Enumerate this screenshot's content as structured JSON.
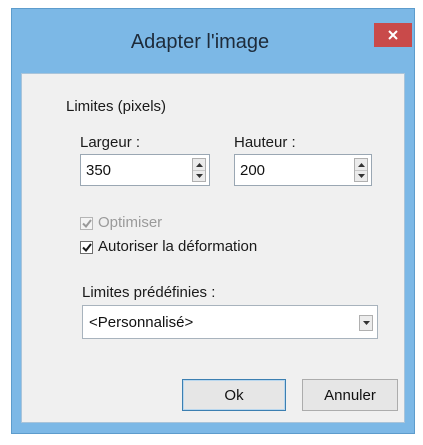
{
  "dialog": {
    "title": "Adapter l'image",
    "close_icon": "close-icon"
  },
  "limits": {
    "heading": "Limites (pixels)",
    "width_label": "Largeur :",
    "width_value": "350",
    "height_label": "Hauteur :",
    "height_value": "200"
  },
  "options": {
    "optimize_label": "Optimiser",
    "optimize_checked": true,
    "optimize_enabled": false,
    "allow_distortion_label": "Autoriser la déformation",
    "allow_distortion_checked": true
  },
  "presets": {
    "label": "Limites prédéfinies :",
    "selected": "<Personnalisé>"
  },
  "buttons": {
    "ok": "Ok",
    "cancel": "Annuler"
  },
  "colors": {
    "frame": "#7cb8e6",
    "close": "#c94a4a",
    "client_bg": "#f0f0f0"
  }
}
